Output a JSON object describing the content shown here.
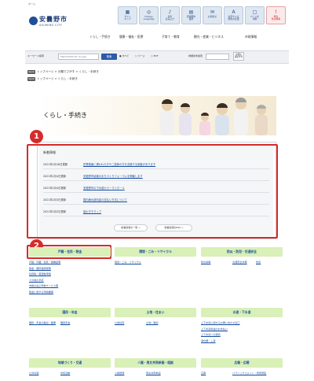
{
  "header": {
    "welcome": "ホーム",
    "logo_jp": "安曇野市",
    "logo_en": "ASUMINO CITY",
    "buttons": [
      {
        "icon": "sitemap-icon",
        "glyph": "▦",
        "label": "サイト\nマップ"
      },
      {
        "icon": "language-icon",
        "glyph": "◎",
        "label": "Foreign\nLanguage"
      },
      {
        "icon": "voice-icon",
        "glyph": "♪",
        "label": "音声\n読み上げ"
      },
      {
        "icon": "calendar-icon",
        "glyph": "▤",
        "label": "安曇野市\n役所"
      },
      {
        "icon": "contact-icon",
        "glyph": "✉",
        "label": "お問合せ"
      },
      {
        "icon": "font-size-icon",
        "glyph": "A",
        "label": "文字サイズ\n配色の変更"
      },
      {
        "icon": "page-icon",
        "glyph": "□",
        "label": "ページを\n印刷"
      },
      {
        "icon": "emergency-icon",
        "glyph": "!",
        "label": "緊急\n防災情報"
      }
    ]
  },
  "gnav": [
    "くらし・手続き",
    "健康・福祉・医療",
    "子育て・教育",
    "観光・産業・ビジネス",
    "市政情報"
  ],
  "search": {
    "label": "キーワード検索",
    "placeholder": "ENHANCED BY Google",
    "button": "検索",
    "radio_all": "● すべて",
    "radio_page": "○ ページ",
    "radio_pdf": "○ PDF",
    "detail_label": "詳細条件検索",
    "detail_button": "詳細な\n検索条件"
  },
  "breadcrumbs": [
    {
      "tag": "現在地",
      "text": "トップページ  >  分類でさがす  >  くらし・手続き"
    },
    {
      "tag": "現在地",
      "text": "トップページ  >  くらし・手続き"
    }
  ],
  "hero": {
    "title": "くらし・手続き"
  },
  "news": {
    "heading": "新着情報",
    "items": [
      {
        "date": "2021年2月16日更新",
        "title": "犯罪被害に遭われた方やご遺族の方を支援する制度があります"
      },
      {
        "date": "2021年2月4日更新",
        "title": "安曇野市協働のまちづくりフォーラムを開催します"
      },
      {
        "date": "2021年2月4日更新",
        "title": "安曇野市の下水道カラーマンホール"
      },
      {
        "date": "2021年2月3日更新",
        "title": "国内線水道料金の支払い方法について"
      },
      {
        "date": "2021年2月2日更新",
        "title": "協わすそマップ"
      }
    ],
    "btn_list": "新着情報の一覧 >",
    "btn_rss": "新着情報のRSS >"
  },
  "annotations": {
    "badge1": "1",
    "badge2": "2"
  },
  "categories": [
    {
      "title": "戸籍・住民・税金",
      "items": [
        "戸籍・印鑑・住民・各種証明",
        "税金・国民健康保険",
        "住民税・軽自動車税",
        "その他の手続",
        "市税の電子申告サービス等",
        "税金に関する申請書等"
      ]
    },
    {
      "title": "環境・ごみ・リサイクル",
      "items": [
        "環境・ごみ・リサイクル"
      ]
    },
    {
      "title": "防災・防犯・交通安全",
      "items": [
        "防災情報",
        "交通安全対策",
        "防犯"
      ]
    },
    {
      "title": "国民・年金",
      "items": [
        "国民・年金の届出・整備",
        "国民年金"
      ]
    },
    {
      "title": "土地・住まい",
      "items": [
        "公営住宅",
        "土地・登記"
      ]
    },
    {
      "title": "水道・下水道",
      "items": [
        "上下水道に関するお問い合わせ窓口",
        "上下水道料金のお支払い",
        "上下水道への接続",
        "浄化槽・し尿"
      ]
    },
    {
      "title": "地域づくり・交通",
      "items": [
        "公共交通",
        "市民活動"
      ]
    },
    {
      "title": "人権・男女共同参画・相談",
      "items": [
        "人権啓発",
        "男女共同参画"
      ]
    },
    {
      "title": "広報・広聴",
      "items": [
        "広報",
        "パブリックコメント・意見募集"
      ]
    }
  ],
  "colors": {
    "accent": "#1f4e9c",
    "category_bg": "#d9f0b8",
    "annotation_red": "#d62b2b"
  }
}
